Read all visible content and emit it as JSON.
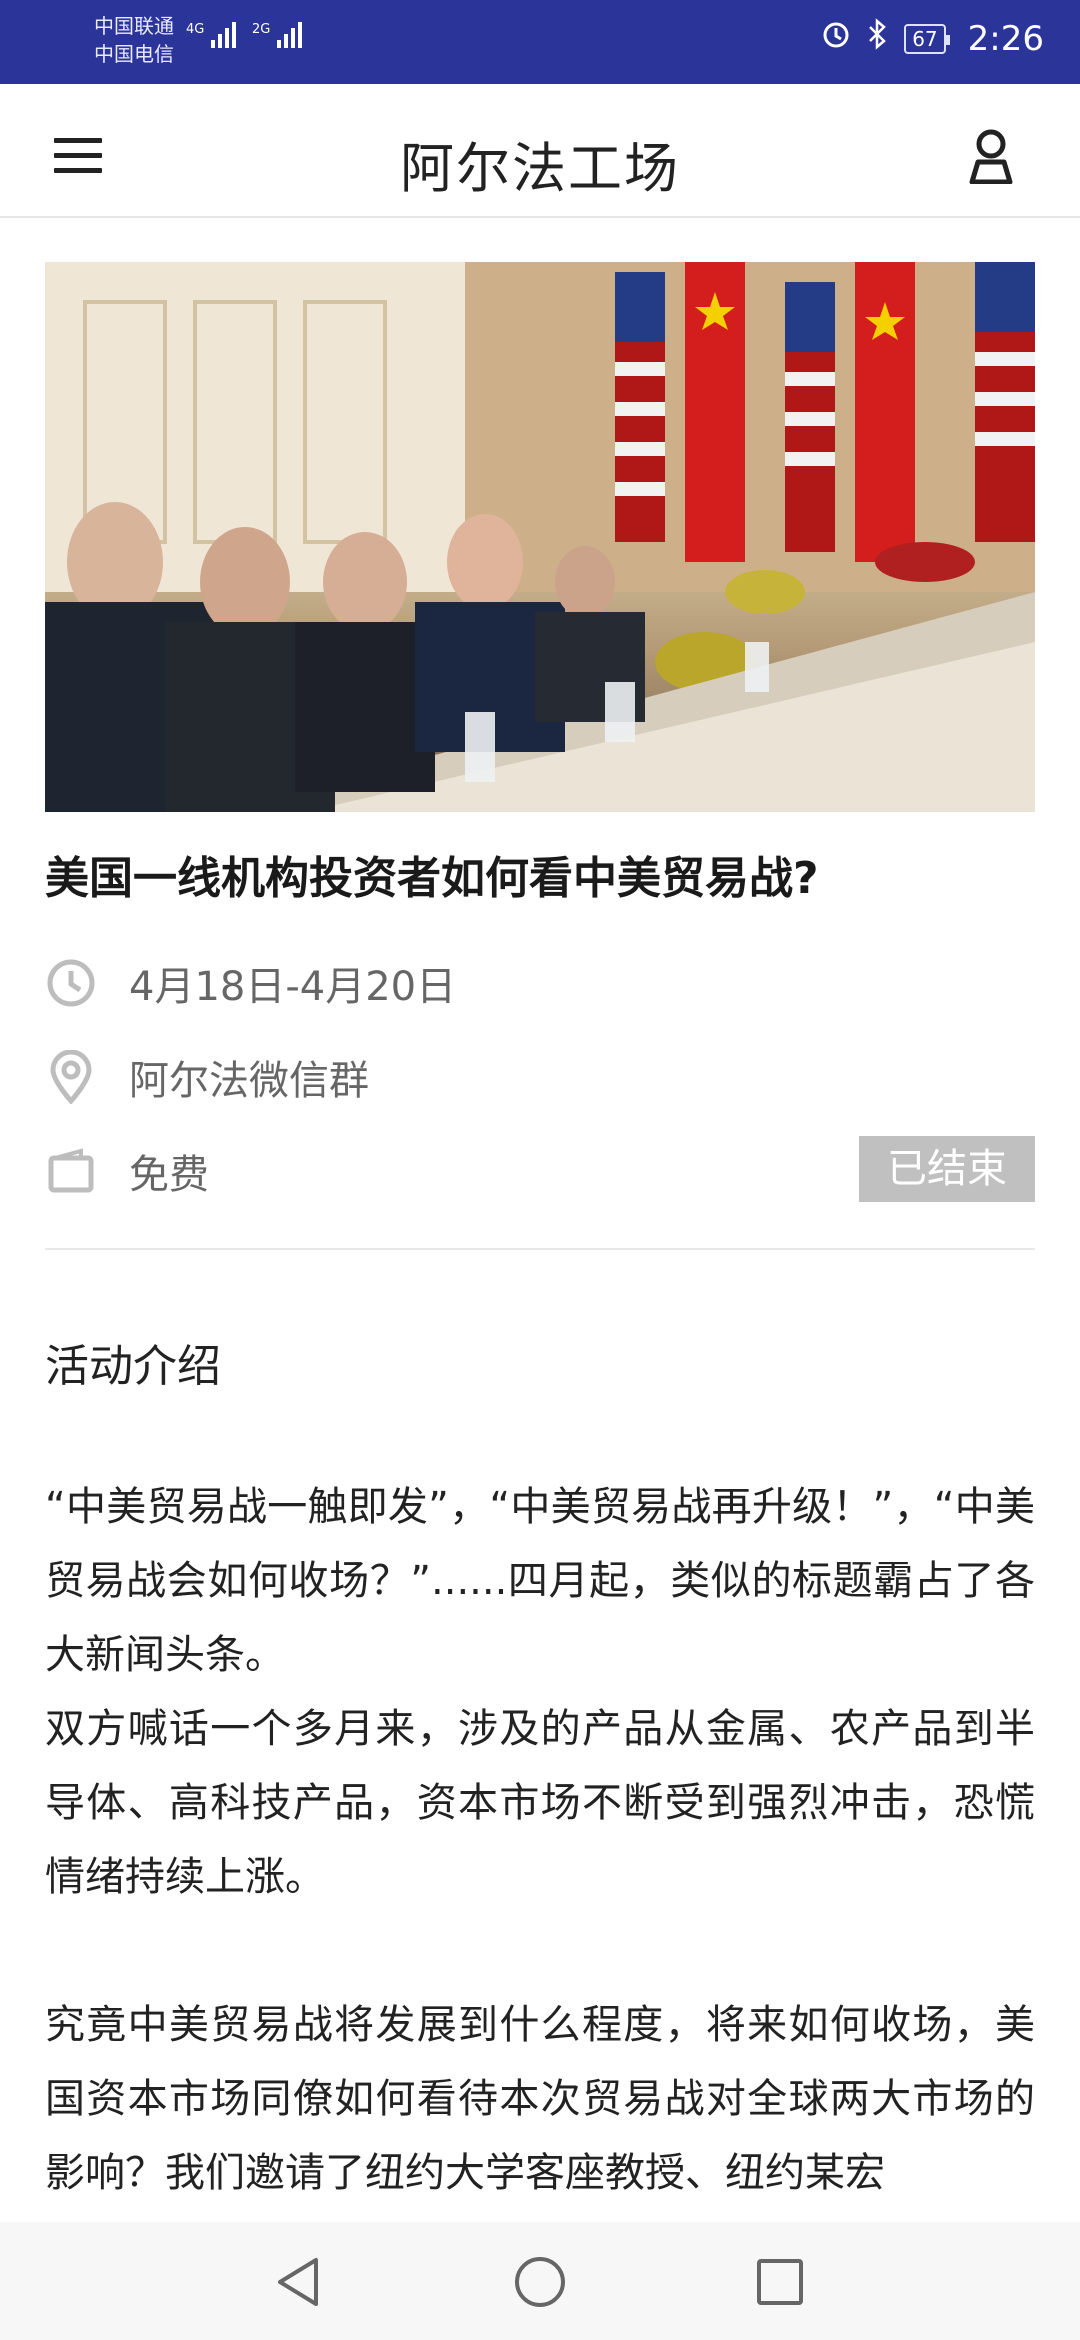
{
  "status_bar": {
    "carrier_1": "中国联通",
    "carrier_2": "中国电信",
    "network_1": "4G",
    "network_2": "2G",
    "battery": "67",
    "time": "2:26"
  },
  "app_bar": {
    "title": "阿尔法工场",
    "menu_icon": "hamburger-menu-icon",
    "user_icon": "user-profile-icon"
  },
  "event": {
    "banner_alt": "photo",
    "title": "美国一线机构投资者如何看中美贸易战?",
    "date": "4月18日-4月20日",
    "location": "阿尔法微信群",
    "price": "免费",
    "status": "已结束"
  },
  "description": {
    "heading": "活动介绍",
    "paragraphs": [
      "“中美贸易战一触即发”，“中美贸易战再升级！”，“中美贸易战会如何收场？”......四月起，类似的标题霸占了各大新闻头条。",
      "双方喊话一个多月来，涉及的产品从金属、农产品到半导体、高科技产品，资本市场不断受到强烈冲击，恐慌情绪持续上涨。",
      "究竟中美贸易战将发展到什么程度，将来如何收场，美国资本市场同僚如何看待本次贸易战对全球两大市场的影响？我们邀请了纽约大学客座教授、纽约某宏"
    ]
  },
  "nav_bar": {
    "back": "back-triangle-icon",
    "home": "home-circle-icon",
    "recents": "recents-square-icon"
  },
  "colors": {
    "status_bar_bg": "#2b3499",
    "badge_bg": "#c0c0c0"
  }
}
